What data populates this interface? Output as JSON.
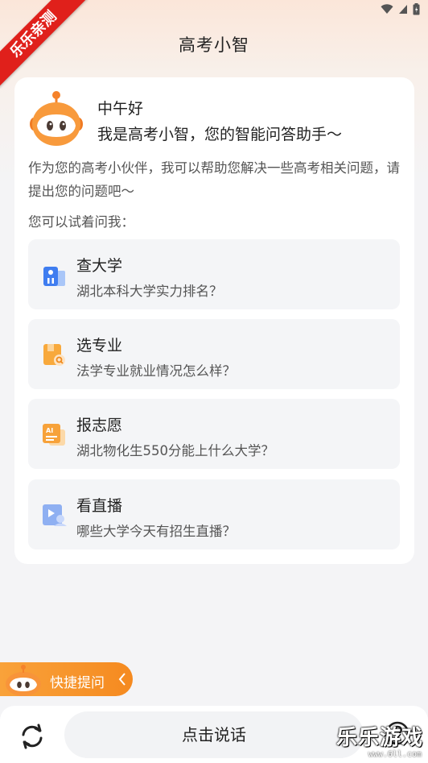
{
  "ribbon": {
    "text": "乐乐亲测"
  },
  "header": {
    "title": "高考小智"
  },
  "card": {
    "greeting": "中午好",
    "subtitle": "我是高考小智，您的智能问答助手～",
    "intro": "作为您的高考小伙伴，我可以帮助您解决一些高考相关问题，请提出您的问题吧～",
    "try_label": "您可以试着问我：",
    "questions": [
      {
        "title": "查大学",
        "desc": "湖北本科大学实力排名？",
        "icon": "university-icon"
      },
      {
        "title": "选专业",
        "desc": "法学专业就业情况怎么样？",
        "icon": "major-book-icon"
      },
      {
        "title": "报志愿",
        "desc": "湖北物化生550分能上什么大学？",
        "icon": "ai-application-icon"
      },
      {
        "title": "看直播",
        "desc": "哪些大学今天有招生直播？",
        "icon": "live-stream-icon"
      }
    ]
  },
  "quick_ask": {
    "label": "快捷提问"
  },
  "bottom": {
    "talk_label": "点击说话"
  },
  "watermark": {
    "main": "乐乐游戏",
    "sub": "www.6ll.com"
  },
  "colors": {
    "accent_orange": "#f58a20",
    "ribbon_red": "#e0201b",
    "item_bg": "#f4f5f7"
  }
}
